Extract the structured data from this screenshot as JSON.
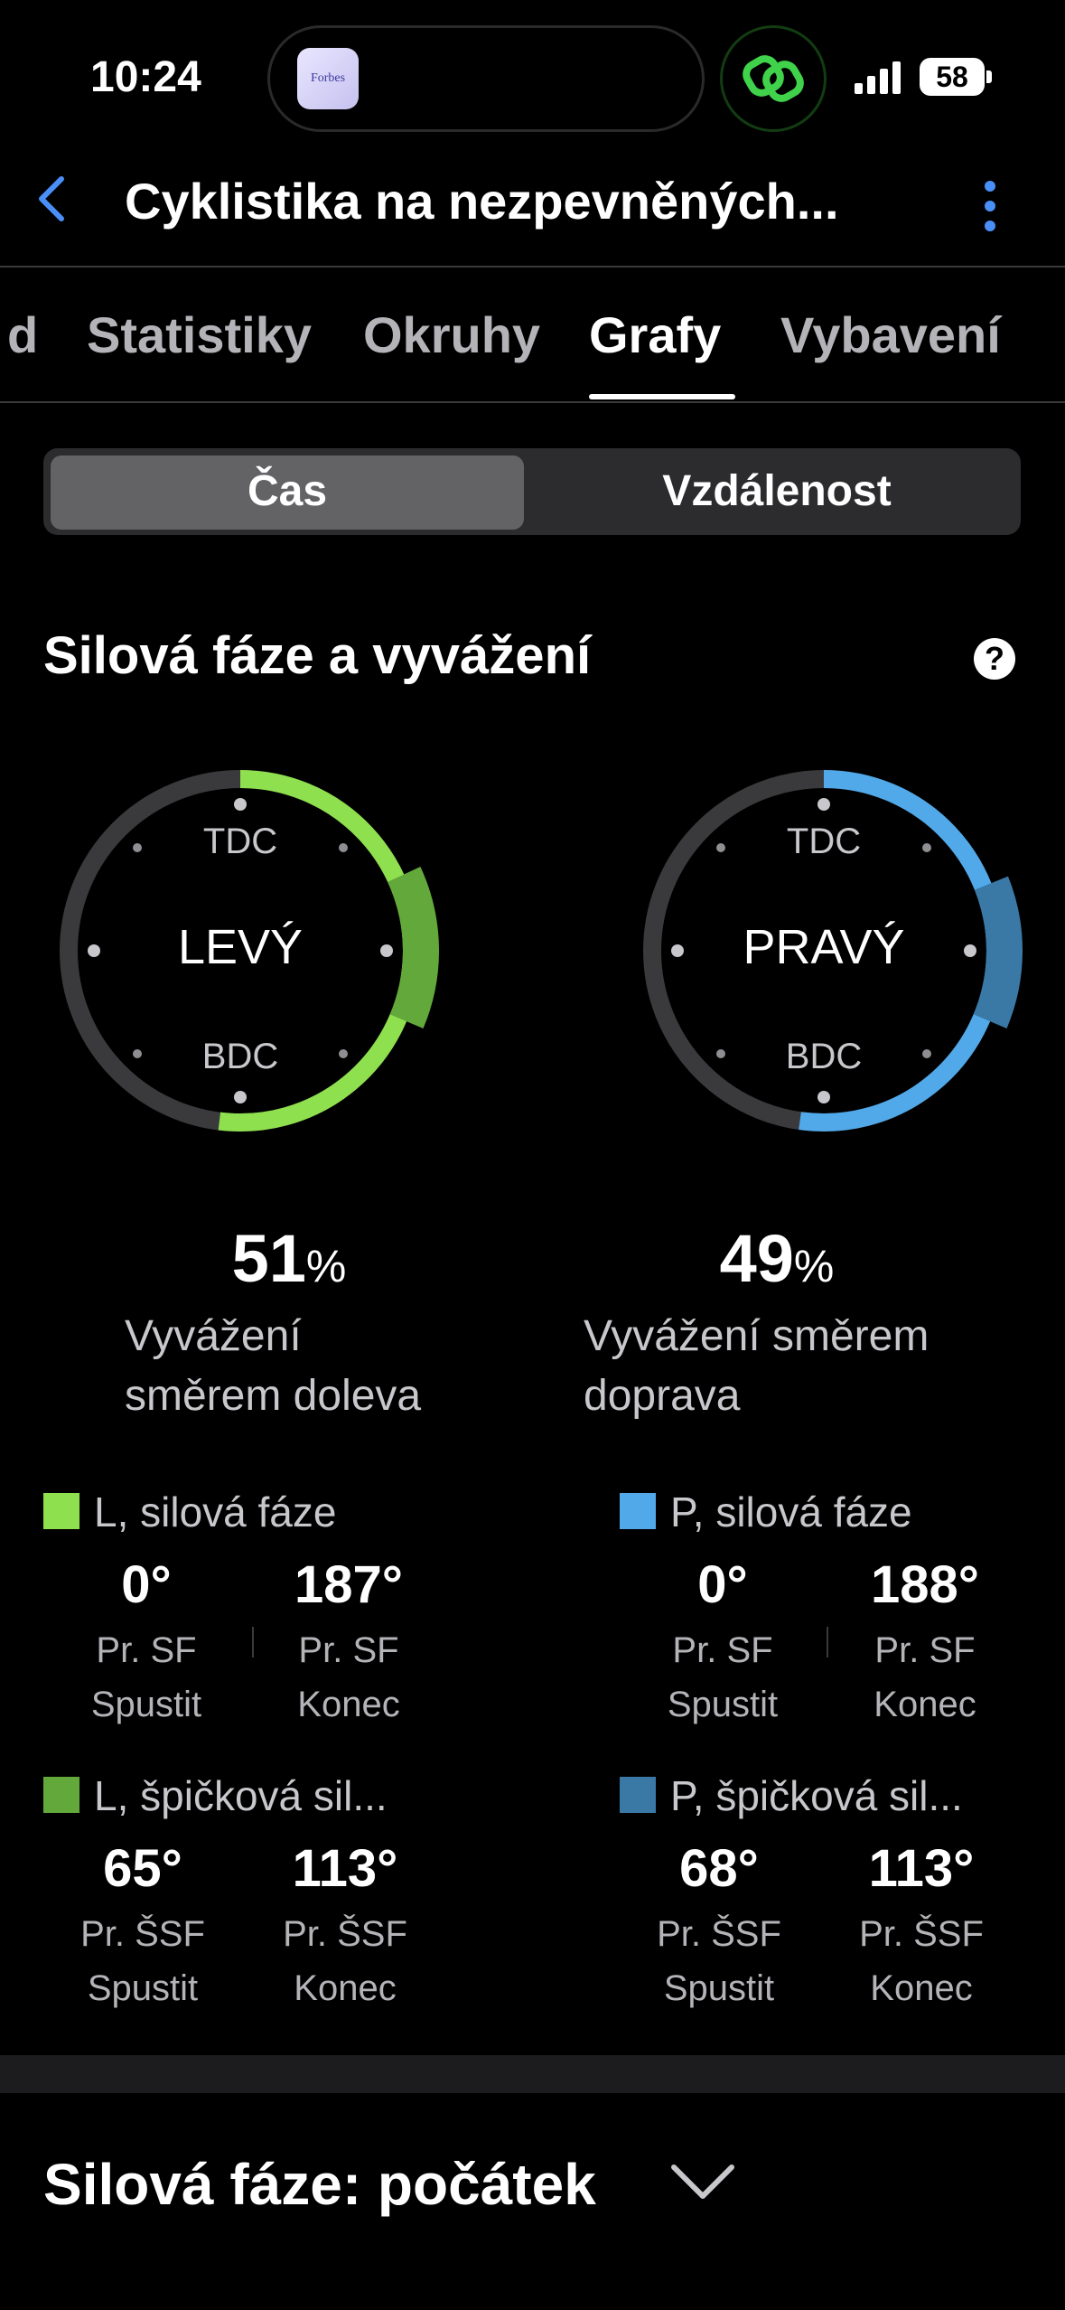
{
  "status": {
    "time": "10:24",
    "battery": "58",
    "island_app_label": "Forbes"
  },
  "nav": {
    "title": "Cyklistika na nezpevněných..."
  },
  "tabs": [
    "d",
    "Statistiky",
    "Okruhy",
    "Grafy",
    "Vybavení"
  ],
  "active_tab": "Grafy",
  "segment": {
    "options": [
      "Čas",
      "Vzdálenost"
    ],
    "selected": "Čas"
  },
  "section": {
    "title": "Silová fáze a vyvážení",
    "help_icon": "?"
  },
  "dials": {
    "left": {
      "name": "LEVÝ",
      "top": "TDC",
      "bottom": "BDC",
      "color": "#8fe04f",
      "peak_color": "#63a83a",
      "power_phase": [
        0,
        187
      ],
      "peak_phase": [
        65,
        113
      ]
    },
    "right": {
      "name": "PRAVÝ",
      "top": "TDC",
      "bottom": "BDC",
      "color": "#51a9ea",
      "peak_color": "#3a78a6",
      "power_phase": [
        0,
        188
      ],
      "peak_phase": [
        68,
        113
      ]
    }
  },
  "balance": {
    "left": {
      "value": "51",
      "unit": "%",
      "label_line1": "Vyvážení",
      "label_line2": "směrem doleva"
    },
    "right": {
      "value": "49",
      "unit": "%",
      "label_line1": "Vyvážení směrem",
      "label_line2": "doprava"
    }
  },
  "stats": {
    "left_phase": {
      "title": "L, silová fáze",
      "color": "#8fe04f",
      "start": {
        "value": "0°",
        "l1": "Pr. SF",
        "l2": "Spustit"
      },
      "end": {
        "value": "187°",
        "l1": "Pr. SF",
        "l2": "Konec"
      }
    },
    "right_phase": {
      "title": "P, silová fáze",
      "color": "#51a9ea",
      "start": {
        "value": "0°",
        "l1": "Pr. SF",
        "l2": "Spustit"
      },
      "end": {
        "value": "188°",
        "l1": "Pr. SF",
        "l2": "Konec"
      }
    },
    "left_peak": {
      "title": "L, špičková sil...",
      "color": "#63a83a",
      "start": {
        "value": "65°",
        "l1": "Pr. ŠSF",
        "l2": "Spustit"
      },
      "end": {
        "value": "113°",
        "l1": "Pr. ŠSF",
        "l2": "Konec"
      }
    },
    "right_peak": {
      "title": "P, špičková sil...",
      "color": "#3a78a6",
      "start": {
        "value": "68°",
        "l1": "Pr. ŠSF",
        "l2": "Spustit"
      },
      "end": {
        "value": "113°",
        "l1": "Pr. ŠSF",
        "l2": "Konec"
      }
    }
  },
  "next_section": {
    "title": "Silová fáze: počátek"
  }
}
